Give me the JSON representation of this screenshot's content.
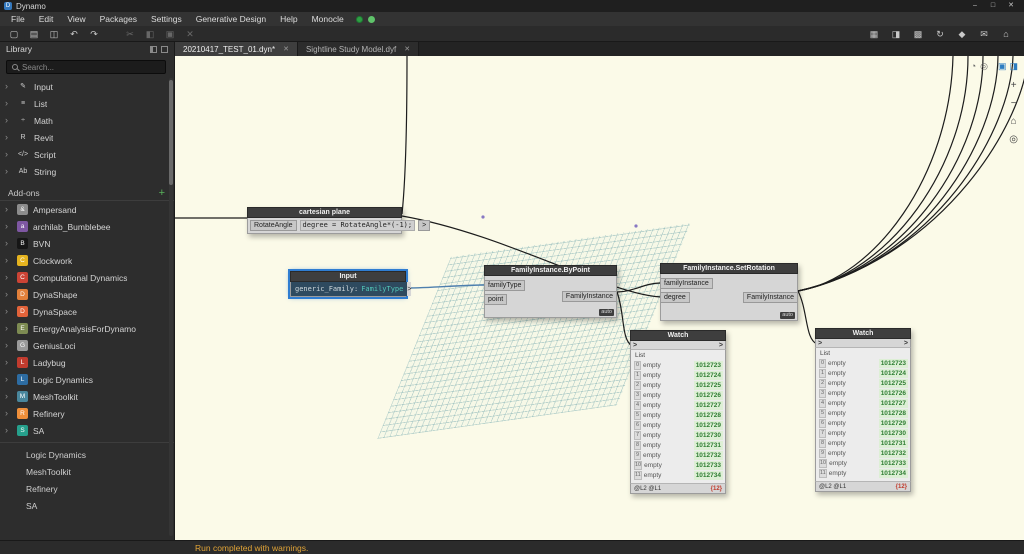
{
  "titlebar": {
    "app_name": "Dynamo",
    "minimize": "–",
    "maximize": "□",
    "close": "✕"
  },
  "menubar": {
    "items": [
      "File",
      "Edit",
      "View",
      "Packages",
      "Settings",
      "Generative Design",
      "Help",
      "Monocle"
    ]
  },
  "toolbar": {
    "left_icons": [
      {
        "glyph": "▢",
        "name": "new-workspace-icon"
      },
      {
        "glyph": "▤",
        "name": "open-file-icon"
      },
      {
        "glyph": "◫",
        "name": "save-icon"
      },
      {
        "glyph": "↶",
        "name": "undo-icon"
      },
      {
        "glyph": "↷",
        "name": "redo-icon"
      }
    ],
    "dim_icons": [
      {
        "glyph": "✂",
        "name": "cut-icon"
      },
      {
        "glyph": "◧",
        "name": "copy-icon"
      },
      {
        "glyph": "▣",
        "name": "paste-icon"
      },
      {
        "glyph": "✕",
        "name": "delete-icon"
      }
    ],
    "right_icons": [
      {
        "glyph": "▦",
        "name": "export-image-icon"
      },
      {
        "glyph": "◨",
        "name": "workspace-preview-icon"
      },
      {
        "glyph": "▩",
        "name": "background-3d-icon"
      },
      {
        "glyph": "↻",
        "name": "refresh-icon"
      },
      {
        "glyph": "◆",
        "name": "geometry-display-icon"
      },
      {
        "glyph": "✉",
        "name": "feedback-icon"
      },
      {
        "glyph": "⌂",
        "name": "home-icon"
      }
    ]
  },
  "tabs": {
    "tab1": "20210417_TEST_01.dyn*",
    "tab2": "Sightline Study Model.dyf",
    "close": "✕"
  },
  "library": {
    "title": "Library",
    "search_placeholder": "Search...",
    "sections": [
      {
        "icon": "✎",
        "label": "Input"
      },
      {
        "icon": "≡",
        "label": "List"
      },
      {
        "icon": "÷",
        "label": "Math"
      },
      {
        "icon": "R",
        "label": "Revit"
      },
      {
        "icon": "</>",
        "label": "Script"
      },
      {
        "icon": "Ab",
        "label": "String"
      }
    ],
    "addons_header": "Add-ons",
    "add_button": "+",
    "addons": [
      {
        "label": "Ampersand",
        "letter": "&",
        "color": "#8c8c8c"
      },
      {
        "label": "archilab_Bumblebee",
        "letter": "a",
        "color": "#7e57a2"
      },
      {
        "label": "BVN",
        "letter": "B",
        "color": "#161616"
      },
      {
        "label": "Clockwork",
        "letter": "C",
        "color": "#e5b31f"
      },
      {
        "label": "Computational Dynamics",
        "letter": "C",
        "color": "#cb4335"
      },
      {
        "label": "DynaShape",
        "letter": "D",
        "color": "#e2803a"
      },
      {
        "label": "DynaSpace",
        "letter": "D",
        "color": "#e2633a"
      },
      {
        "label": "EnergyAnalysisForDynamo",
        "letter": "E",
        "color": "#7d8b52"
      },
      {
        "label": "GeniusLoci",
        "letter": "G",
        "color": "#9a9a9a"
      },
      {
        "label": "Ladybug",
        "letter": "L",
        "color": "#c13b2e"
      },
      {
        "label": "Logic Dynamics",
        "letter": "L",
        "color": "#2d6ca2"
      },
      {
        "label": "MeshToolkit",
        "letter": "M",
        "color": "#49869c"
      },
      {
        "label": "Refinery",
        "letter": "R",
        "color": "#ef8f3a"
      },
      {
        "label": "SA",
        "letter": "S",
        "color": "#26a08c"
      }
    ],
    "plain_items": [
      "Logic Dynamics",
      "MeshToolkit",
      "Refinery",
      "SA"
    ]
  },
  "canvas": {
    "code_block": {
      "title": "cartesian plane",
      "input_port": "RotateAngle",
      "code": "degree = RotateAngle*(-1);",
      "output_port": ">"
    },
    "input_node": {
      "title": "Input",
      "name": "generic_Family:",
      "type": "FamilyType",
      "output_port": ">"
    },
    "by_point": {
      "title": "FamilyInstance.ByPoint",
      "inputs": [
        "familyType",
        "point"
      ],
      "output": "FamilyInstance",
      "lacing": "auto"
    },
    "set_rotation": {
      "title": "FamilyInstance.SetRotation",
      "inputs": [
        "familyInstance",
        "degree"
      ],
      "output": "FamilyInstance",
      "lacing": "auto"
    },
    "watch_title": "Watch",
    "watch_list_label": "List",
    "watch_port_glyph": ">",
    "watch_footer_levels": "@L2 @L1",
    "watch_footer_count": "{12}"
  },
  "watch_rows": [
    {
      "i": "0",
      "k": "empty",
      "v": "1012723"
    },
    {
      "i": "1",
      "k": "empty",
      "v": "1012724"
    },
    {
      "i": "2",
      "k": "empty",
      "v": "1012725"
    },
    {
      "i": "3",
      "k": "empty",
      "v": "1012726"
    },
    {
      "i": "4",
      "k": "empty",
      "v": "1012727"
    },
    {
      "i": "5",
      "k": "empty",
      "v": "1012728"
    },
    {
      "i": "6",
      "k": "empty",
      "v": "1012729"
    },
    {
      "i": "7",
      "k": "empty",
      "v": "1012730"
    },
    {
      "i": "8",
      "k": "empty",
      "v": "1012731"
    },
    {
      "i": "9",
      "k": "empty",
      "v": "1012732"
    },
    {
      "i": "10",
      "k": "empty",
      "v": "1012733"
    },
    {
      "i": "11",
      "k": "empty",
      "v": "1012734"
    }
  ],
  "canvas_controls": {
    "view_icons": [
      {
        "glyph": "◔",
        "name": "orbit-view-icon"
      },
      {
        "glyph": "◎",
        "name": "pan-view-icon"
      }
    ],
    "mode_icons": [
      {
        "glyph": "▣",
        "name": "geometry-view-icon"
      },
      {
        "glyph": "◨",
        "name": "graph-view-icon"
      }
    ],
    "zoom_icons": [
      {
        "glyph": "+",
        "name": "zoom-in-icon"
      },
      {
        "glyph": "−",
        "name": "zoom-out-icon"
      },
      {
        "glyph": "⌂",
        "name": "zoom-fit-icon"
      },
      {
        "glyph": "◎",
        "name": "pan-icon"
      }
    ]
  },
  "statusbar": {
    "message": "Run completed with warnings."
  },
  "colors": {
    "selection_blue": "#2f7dd1",
    "wire_black": "#1c1c1c",
    "wire_selected_blue": "#4d7fae",
    "watch_value_green": "#2e7d32",
    "status_warning": "#e1a437",
    "canvas_bg": "#fbfae8"
  }
}
